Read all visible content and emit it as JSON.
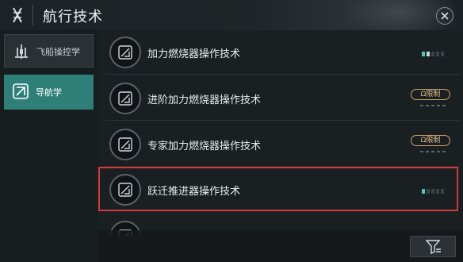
{
  "header": {
    "title": "航行技术"
  },
  "sidebar": {
    "items": [
      {
        "label": "飞船操控学",
        "icon": "ship-control-icon",
        "active": false
      },
      {
        "label": "导航学",
        "icon": "navigation-icon",
        "active": true
      }
    ]
  },
  "skills": [
    {
      "name": "加力燃烧器操作技术",
      "level": {
        "current": 2,
        "max": 5
      }
    },
    {
      "name": "进阶加力燃烧器操作技术",
      "limit_label": "Ω限制"
    },
    {
      "name": "专家加力燃烧器操作技术",
      "limit_label": "Ω限制"
    },
    {
      "name": "跃迁推进器操作技术",
      "level": {
        "current": 1,
        "max": 5
      },
      "selected": true
    },
    {
      "name": ""
    }
  ],
  "icons": {
    "header": "logo-emblem-icon",
    "close": "close-icon",
    "skill": "skill-leaf-icon",
    "filter": "filter-icon"
  },
  "colors": {
    "accent": "#2f7f79",
    "level_current": "#4ec6b8",
    "limit": "#c9a36b",
    "highlight": "#d03a3a"
  }
}
